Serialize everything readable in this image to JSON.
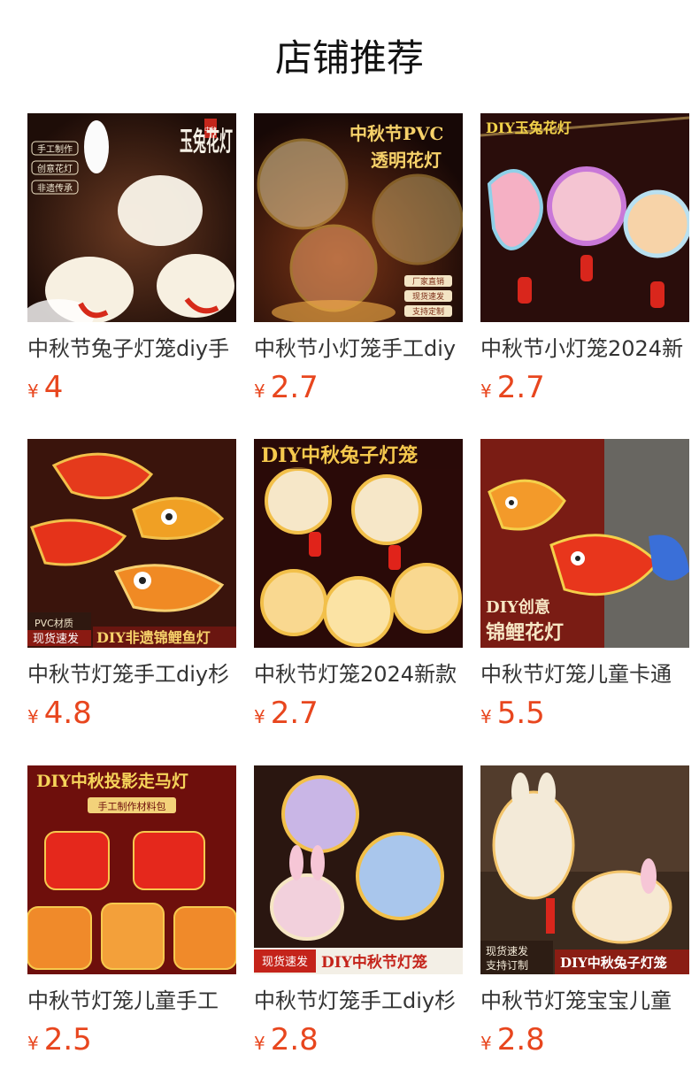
{
  "page": {
    "title": "店铺推荐",
    "currency": "¥"
  },
  "products": [
    {
      "name": "中秋节兔子灯笼diy手",
      "price": "4",
      "image": {
        "bg": "#3a1a10",
        "accent": "#f6f1e6",
        "headline": "玉兔花灯",
        "tags": [
          "手工制作",
          "创意花灯",
          "非遗传承"
        ],
        "seal": "中秋"
      }
    },
    {
      "name": "中秋节小灯笼手工diy",
      "price": "2.7",
      "image": {
        "bg": "#2b0f0a",
        "accent": "#f7c64c",
        "headline": "中秋节PVC",
        "subline": "透明花灯",
        "tags": [
          "厂家直销",
          "现货速发",
          "支持定制"
        ]
      }
    },
    {
      "name": "中秋节小灯笼2024新",
      "price": "2.7",
      "image": {
        "bg": "#2a0d0b",
        "accent": "#f2d24a",
        "headline": "DIY玉兔花灯"
      }
    },
    {
      "name": "中秋节灯笼手工diy杉",
      "price": "4.8",
      "image": {
        "bg": "#3a140c",
        "accent": "#e83a1a",
        "tags": [
          "PVC材质",
          "现货速发"
        ],
        "footer": "DIY非遗锦鲤鱼灯"
      }
    },
    {
      "name": "中秋节灯笼2024新款",
      "price": "2.7",
      "image": {
        "bg": "#2a0a08",
        "accent": "#f6c94d",
        "headline": "DIY中秋兔子灯笼"
      }
    },
    {
      "name": "中秋节灯笼儿童卡通",
      "price": "5.5",
      "image": {
        "bg": "#7a1c14",
        "accent": "#f3a23a",
        "headline": "DIY创意",
        "subline": "锦鲤花灯"
      }
    },
    {
      "name": "中秋节灯笼儿童手工",
      "price": "2.5",
      "image": {
        "bg": "#6e0f0c",
        "accent": "#f6d45a",
        "headline": "DIY中秋投影走马灯",
        "subline": "手工制作材料包"
      }
    },
    {
      "name": "中秋节灯笼手工diy杉",
      "price": "2.8",
      "image": {
        "bg": "#2a1610",
        "accent": "#f4c84a",
        "tags": [
          "现货速发"
        ],
        "footer": "DIY中秋节灯笼"
      }
    },
    {
      "name": "中秋节灯笼宝宝儿童",
      "price": "2.8",
      "image": {
        "bg": "#3b2a1e",
        "accent": "#f3ead8",
        "tags": [
          "现货速发",
          "支持订制"
        ],
        "footer": "DIY中秋兔子灯笼"
      }
    }
  ]
}
